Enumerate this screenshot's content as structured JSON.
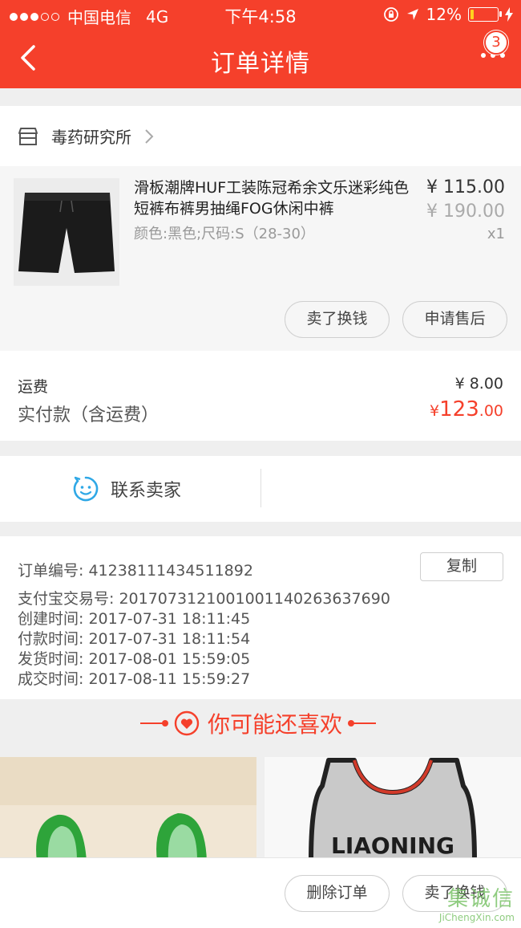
{
  "status_bar": {
    "carrier": "中国电信",
    "network": "4G",
    "time": "下午4:58",
    "battery": "12%",
    "battery_level": 0.12
  },
  "nav": {
    "title": "订单详情",
    "badge_count": "3"
  },
  "shop": {
    "name": "毒药研究所"
  },
  "product": {
    "title": "滑板潮牌HUF工装陈冠希余文乐迷彩纯色短裤布裤男抽绳FOG休闲中裤",
    "attributes": "颜色:黑色;尺码:S（28-30）",
    "price": "¥ 115.00",
    "original_price": "¥ 190.00",
    "quantity": "x1",
    "sell_button": "卖了换钱",
    "after_sale_button": "申请售后"
  },
  "fees": {
    "shipping_label": "运费",
    "shipping_value": "¥ 8.00",
    "paid_label": "实付款（含运费）",
    "paid_currency": "¥",
    "paid_int": "123",
    "paid_dec": ".00"
  },
  "contact": {
    "label": "联系卖家"
  },
  "order_info": {
    "order_no": "订单编号:   41238111434511892",
    "alipay_no": "支付宝交易号:   2017073121001001140263637690",
    "created": "创建时间:   2017-07-31 18:11:45",
    "paid": "付款时间:   2017-07-31 18:11:54",
    "shipped": "发货时间:   2017-08-01 15:59:05",
    "completed": "成交时间:   2017-08-11 15:59:27",
    "copy_button": "复制"
  },
  "recommend": {
    "title": "你可能还喜欢",
    "jersey_text": "LIAONING"
  },
  "bottom": {
    "delete_button": "删除订单",
    "sell_button": "卖了换钱"
  },
  "watermark": {
    "cn": "集诚信",
    "en": "JiChengXin.com"
  },
  "colors": {
    "accent": "#f5402b",
    "contact_icon": "#2fa8e6"
  }
}
